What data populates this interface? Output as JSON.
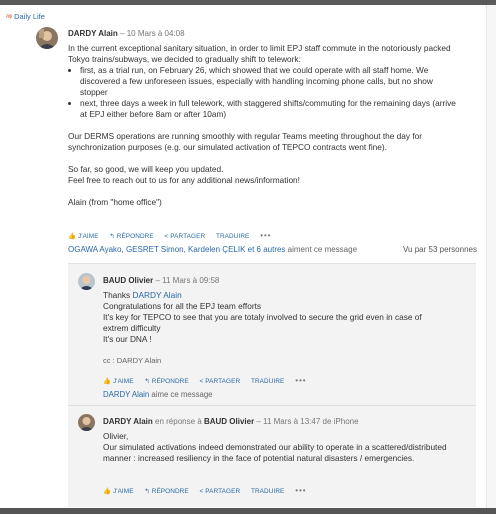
{
  "group": {
    "icon": "group-icon",
    "name": "Daily Life"
  },
  "post": {
    "author": "DARDY Alain",
    "date": "– 10 Mars à 04:08",
    "intro": "In the current exceptional sanitary situation, in order to limit EPJ staff commute in the notoriously packed Tokyo trains/subways, we decided to gradually shift to telework:",
    "bullets": [
      "first, as a trial run, on February 26, which showed that we could operate with all staff home. We discovered a few unforeseen issues, especially with handling incoming phone calls, but no show stopper",
      "next, three days a week in full telework, with staggered shifts/commuting for the remaining days (arrive at EPJ either before 8am or after 10am)"
    ],
    "para2": "Our DERMS operations are running smoothly with regular Teams meeting throughout the day for synchronization purposes (e.g. our simulated activation of TEPCO contracts went fine).",
    "para3a": "So far, so good, we will keep you updated.",
    "para3b": "Feel free to reach out to us for any additional news/information!",
    "signature": "Alain (from \"home office\")",
    "actions": {
      "like": "J'AIME",
      "reply": "RÉPONDRE",
      "share": "PARTAGER",
      "translate": "TRADUIRE",
      "more": "•••"
    },
    "likes_names": "OGAWA Ayako, GESRET Simon, Kardelen ÇELIK et 6 autres",
    "likes_rest": " aiment ce message",
    "seen_by": "Vu par 53 personnes"
  },
  "reply1": {
    "author": "BAUD Olivier",
    "date": "– 11 Mars à 09:58",
    "thanks": "Thanks ",
    "mention": "DARDY Alain",
    "line2": "Congratulations for all the EPJ team efforts",
    "line3": "It's key for TEPCO to see that you are totaly involved to secure the grid even in case of extrem difficulty",
    "line4": "It's our DNA !",
    "cc": "cc : DARDY Alain",
    "actions": {
      "like": "J'AIME",
      "reply": "RÉPONDRE",
      "share": "PARTAGER",
      "translate": "TRADUIRE",
      "more": "•••"
    },
    "liked_name": "DARDY Alain",
    "liked_rest": " aime ce message"
  },
  "reply2": {
    "author": "DARDY Alain",
    "in_reply": " en réponse à ",
    "reply_to": "BAUD Olivier",
    "date": " – 11 Mars à 13:47 de iPhone",
    "line1": "Olivier,",
    "line2": "Our simulated activations indeed demonstrated our ability to operate in a scattered/distributed manner : increased resiliency in the face of potential natural disasters / emergencies.",
    "actions": {
      "like": "J'AIME",
      "reply": "RÉPONDRE",
      "share": "PARTAGER",
      "translate": "TRADUIRE",
      "more": "•••"
    }
  },
  "colors": {
    "link": "#2a6aa6",
    "reply_bg": "#f3f3f3"
  }
}
